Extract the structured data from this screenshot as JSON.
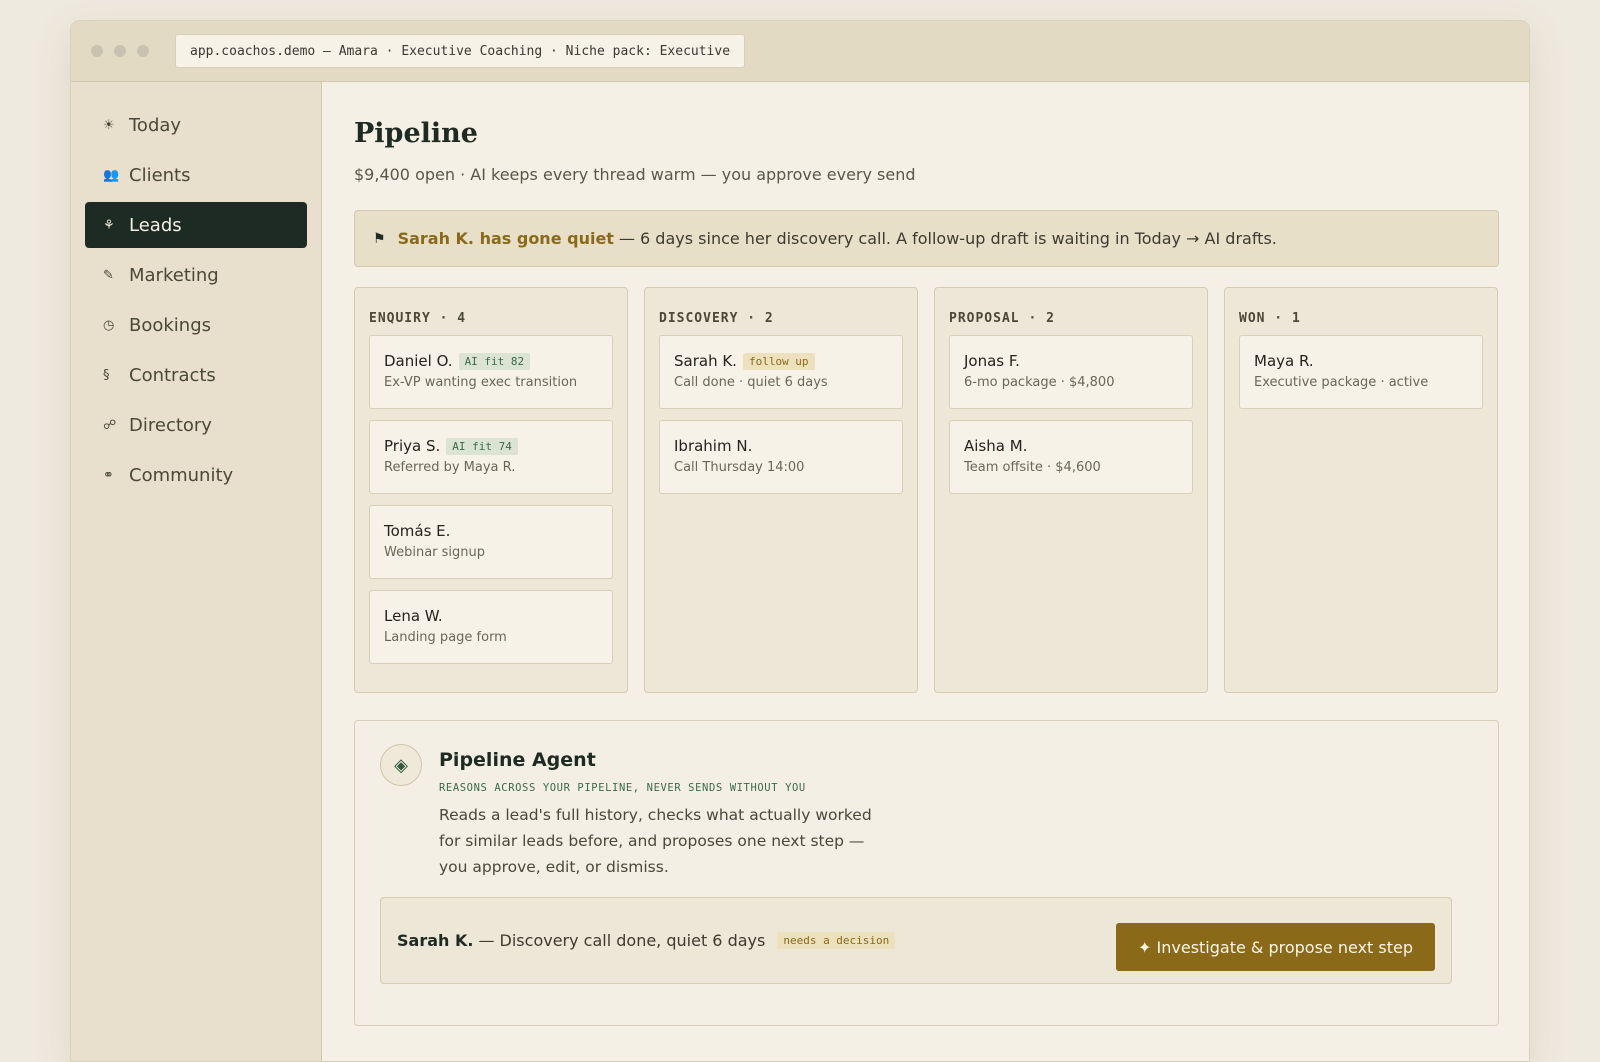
{
  "window": {
    "url": "app.coachos.demo — Amara · Executive Coaching · Niche pack: Executive"
  },
  "sidebar": {
    "items": [
      {
        "label": "Today",
        "icon": "☀",
        "active": false
      },
      {
        "label": "Clients",
        "icon": "👥",
        "active": false
      },
      {
        "label": "Leads",
        "icon": "⚘",
        "active": true
      },
      {
        "label": "Marketing",
        "icon": "✎",
        "active": false
      },
      {
        "label": "Bookings",
        "icon": "◷",
        "active": false
      },
      {
        "label": "Contracts",
        "icon": "§",
        "active": false
      },
      {
        "label": "Directory",
        "icon": "☍",
        "active": false
      },
      {
        "label": "Community",
        "icon": "⚭",
        "active": false
      }
    ]
  },
  "header": {
    "title": "Pipeline",
    "subtitle": "$9,400 open · AI keeps every thread warm — you approve every send"
  },
  "alert": {
    "highlight": "Sarah K. has gone quiet",
    "text": "— 6 days since her discovery call. A follow-up draft is waiting in Today → AI drafts."
  },
  "board": {
    "columns": [
      {
        "title": "ENQUIRY · 4",
        "cards": [
          {
            "name": "Daniel O.",
            "tag": "AI fit 82",
            "tag_type": "fit",
            "desc": "Ex-VP wanting exec transition"
          },
          {
            "name": "Priya S.",
            "tag": "AI fit 74",
            "tag_type": "fit",
            "desc": "Referred by Maya R."
          },
          {
            "name": "Tomás E.",
            "tag": "",
            "tag_type": "",
            "desc": "Webinar signup"
          },
          {
            "name": "Lena W.",
            "tag": "",
            "tag_type": "",
            "desc": "Landing page form"
          }
        ]
      },
      {
        "title": "DISCOVERY · 2",
        "cards": [
          {
            "name": "Sarah K.",
            "tag": "follow up",
            "tag_type": "follow",
            "desc": "Call done · quiet 6 days"
          },
          {
            "name": "Ibrahim N.",
            "tag": "",
            "tag_type": "",
            "desc": "Call Thursday 14:00"
          }
        ]
      },
      {
        "title": "PROPOSAL · 2",
        "cards": [
          {
            "name": "Jonas F.",
            "tag": "",
            "tag_type": "",
            "desc": "6-mo package · $4,800"
          },
          {
            "name": "Aisha M.",
            "tag": "",
            "tag_type": "",
            "desc": "Team offsite · $4,600"
          }
        ]
      },
      {
        "title": "WON · 1",
        "cards": [
          {
            "name": "Maya R.",
            "tag": "",
            "tag_type": "",
            "desc": "Executive package · active"
          }
        ]
      }
    ]
  },
  "agent": {
    "icon": "◈",
    "title": "Pipeline Agent",
    "kicker": "REASONS ACROSS YOUR PIPELINE, NEVER SENDS WITHOUT YOU",
    "description": "Reads a lead's full history, checks what actually worked for similar leads before, and proposes one next step — you approve, edit, or dismiss.",
    "decision": {
      "name": "Sarah K.",
      "text": "— Discovery call done, quiet 6 days",
      "tag": "needs a decision"
    },
    "cta_label": "✦ Investigate & propose next step"
  }
}
